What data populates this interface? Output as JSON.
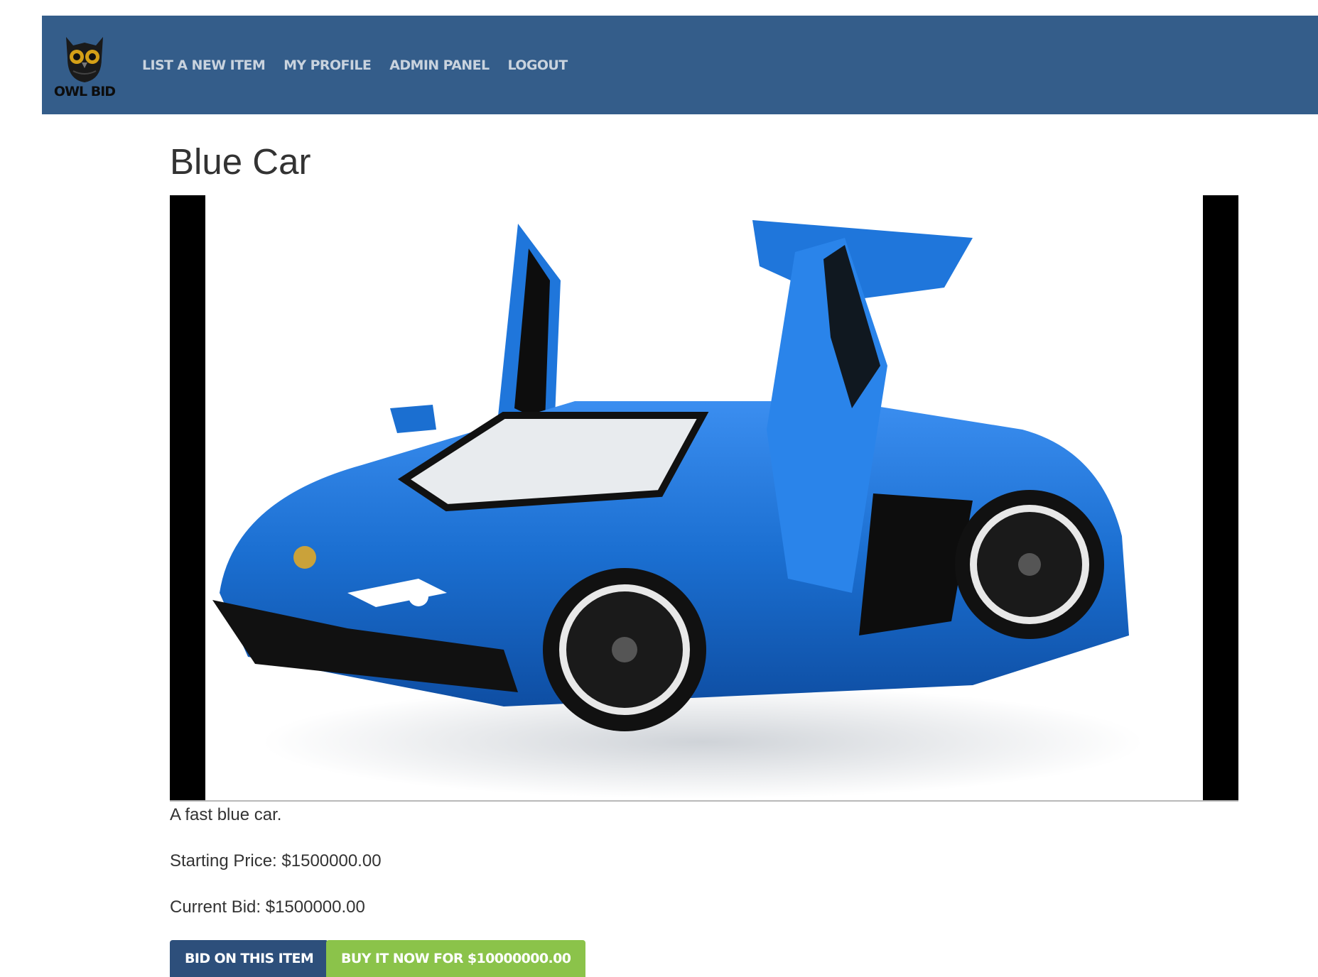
{
  "nav": {
    "logo_text": "OWL BID",
    "links": [
      "LIST A NEW ITEM",
      "MY PROFILE",
      "ADMIN PANEL",
      "LOGOUT"
    ]
  },
  "item": {
    "title": "Blue Car",
    "description": "A fast blue car.",
    "starting_price": "Starting Price: $1500000.00",
    "current_bid": "Current Bid: $1500000.00",
    "image_subject": "blue-sports-car"
  },
  "actions": {
    "bid_label": "BID ON THIS ITEM",
    "buy_label": "BUY IT NOW FOR $10000000.00"
  },
  "colors": {
    "navbar": "#345d8a",
    "bid_button": "#2d4f7b",
    "buy_button": "#8bc34a",
    "car_blue": "#1b6fd1"
  }
}
